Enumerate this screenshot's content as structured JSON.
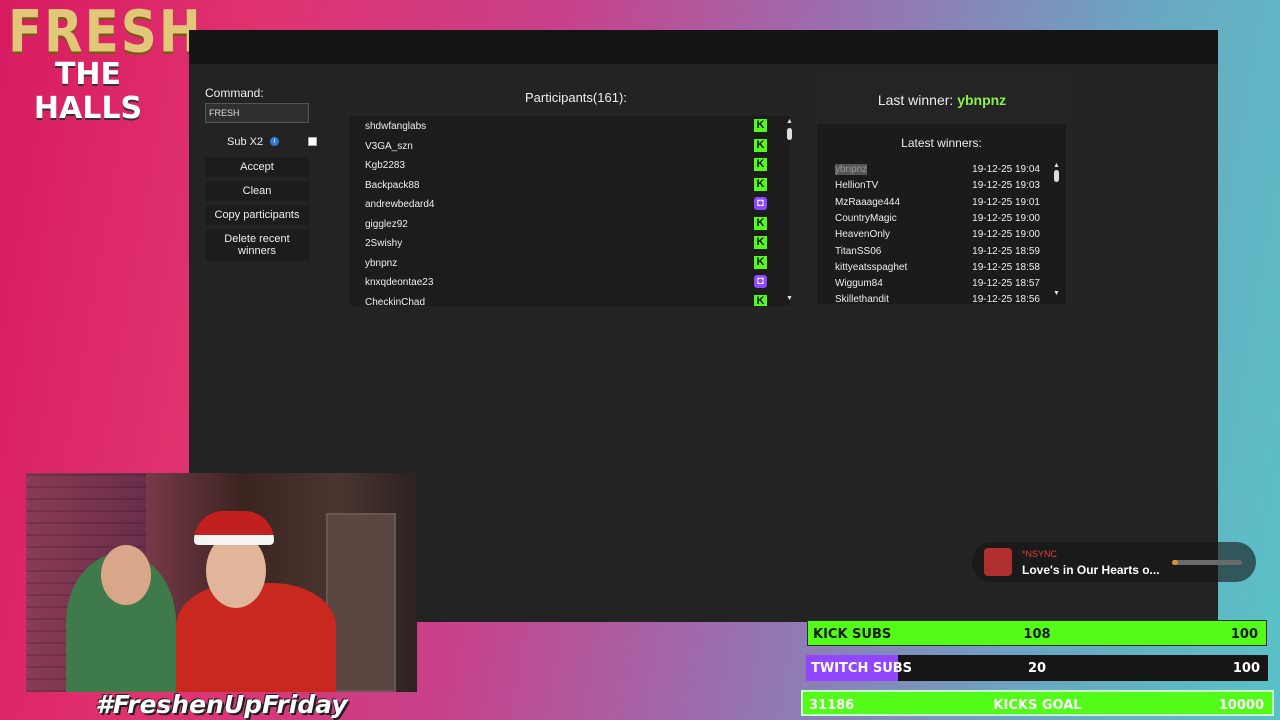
{
  "branding": {
    "logo_line1": "FRESH",
    "logo_line2": "THE HALLS",
    "hashtag": "#FreshenUpFriday"
  },
  "giveaway": {
    "command_label": "Command:",
    "command_value": "FRESH",
    "sub_x2_label": "Sub X2",
    "info_icon": "i",
    "buttons": {
      "accept": "Accept",
      "clean": "Clean",
      "copy": "Copy participants",
      "delete": "Delete recent winners"
    },
    "participants_title": "Participants(161):",
    "participants": [
      {
        "name": "shdwfanglabs",
        "platform": "kick"
      },
      {
        "name": "V3GA_szn",
        "platform": "kick"
      },
      {
        "name": "Kgb2283",
        "platform": "kick"
      },
      {
        "name": "Backpack88",
        "platform": "kick"
      },
      {
        "name": "andrewbedard4",
        "platform": "twitch"
      },
      {
        "name": "gigglez92",
        "platform": "kick"
      },
      {
        "name": "2Swishy",
        "platform": "kick"
      },
      {
        "name": "ybnpnz",
        "platform": "kick"
      },
      {
        "name": "knxqdeontae23",
        "platform": "twitch"
      },
      {
        "name": "CheckinChad",
        "platform": "kick"
      }
    ],
    "last_winner_label": "Last winner:",
    "last_winner": "ybnpnz",
    "latest_winners_title": "Latest winners:",
    "latest_winners": [
      {
        "name": "ybnpnz",
        "time": "19-12-25 19:04",
        "selected": true
      },
      {
        "name": "HellionTV",
        "time": "19-12-25 19:03"
      },
      {
        "name": "MzRaaage444",
        "time": "19-12-25 19:01"
      },
      {
        "name": "CountryMagic",
        "time": "19-12-25 19:00"
      },
      {
        "name": "HeavenOnly",
        "time": "19-12-25 19:00"
      },
      {
        "name": "TitanSS06",
        "time": "19-12-25 18:59"
      },
      {
        "name": "kittyeatsspaghet",
        "time": "19-12-25 18:58"
      },
      {
        "name": "Wiggum84",
        "time": "19-12-25 18:57"
      },
      {
        "name": "Skillethandit",
        "time": "19-12-25 18:56"
      }
    ]
  },
  "now_playing": {
    "artist": "*NSYNC",
    "title": "Love's in Our Hearts o...",
    "progress": 0.08
  },
  "goals": {
    "kick_subs": {
      "label": "KICK SUBS",
      "current": "108",
      "target": "100",
      "fraction": 1.0
    },
    "twitch_subs": {
      "label": "TWITCH SUBS",
      "current": "20",
      "target": "100",
      "fraction": 0.2
    },
    "kicks_goal": {
      "label": "KICKS GOAL",
      "current": "31186",
      "target": "10000",
      "fraction": 1.0
    }
  },
  "colors": {
    "kick_green": "#53fc18",
    "twitch_purple": "#9146ff",
    "winner_green": "#8ef04a"
  }
}
